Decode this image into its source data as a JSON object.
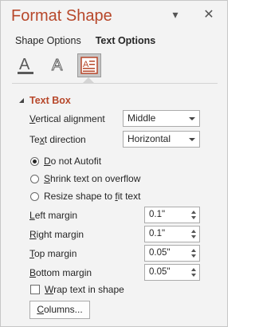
{
  "pane": {
    "title": "Format Shape",
    "colors": {
      "title": "#b7472a",
      "section": "#b7472a",
      "background": "#f3f3f3"
    }
  },
  "tabs": [
    {
      "label": "Shape Options",
      "active": false
    },
    {
      "label": "Text Options",
      "active": true
    }
  ],
  "format_icons": [
    "text-fill-outline-icon",
    "text-effects-icon",
    "textbox-icon"
  ],
  "section": {
    "label": "Text Box",
    "expanded": true
  },
  "fields": {
    "vertical_alignment": {
      "label_first": "V",
      "label_rest": "ertical alignment",
      "value": "Middle"
    },
    "text_direction": {
      "label_first": "Te",
      "label_u": "x",
      "label_rest": "t direction",
      "value": "Horizontal"
    }
  },
  "autofit": [
    {
      "label_u": "D",
      "label_rest": "o not Autofit",
      "checked": true
    },
    {
      "label_u": "S",
      "label_rest": "hrink text on overflow",
      "checked": false
    },
    {
      "label_pre": "Resize shape to ",
      "label_u": "f",
      "label_rest": "it text",
      "checked": false
    }
  ],
  "margins": [
    {
      "label_u": "L",
      "label_rest": "eft margin",
      "value": "0.1\""
    },
    {
      "label_u": "R",
      "label_rest": "ight margin",
      "value": "0.1\""
    },
    {
      "label_u": "T",
      "label_rest": "op margin",
      "value": "0.05\""
    },
    {
      "label_u": "B",
      "label_rest": "ottom margin",
      "value": "0.05\""
    }
  ],
  "wrap": {
    "label_u": "W",
    "label_rest": "rap text in shape",
    "checked": false
  },
  "columns_button": {
    "label_u": "C",
    "label_rest": "olumns..."
  }
}
